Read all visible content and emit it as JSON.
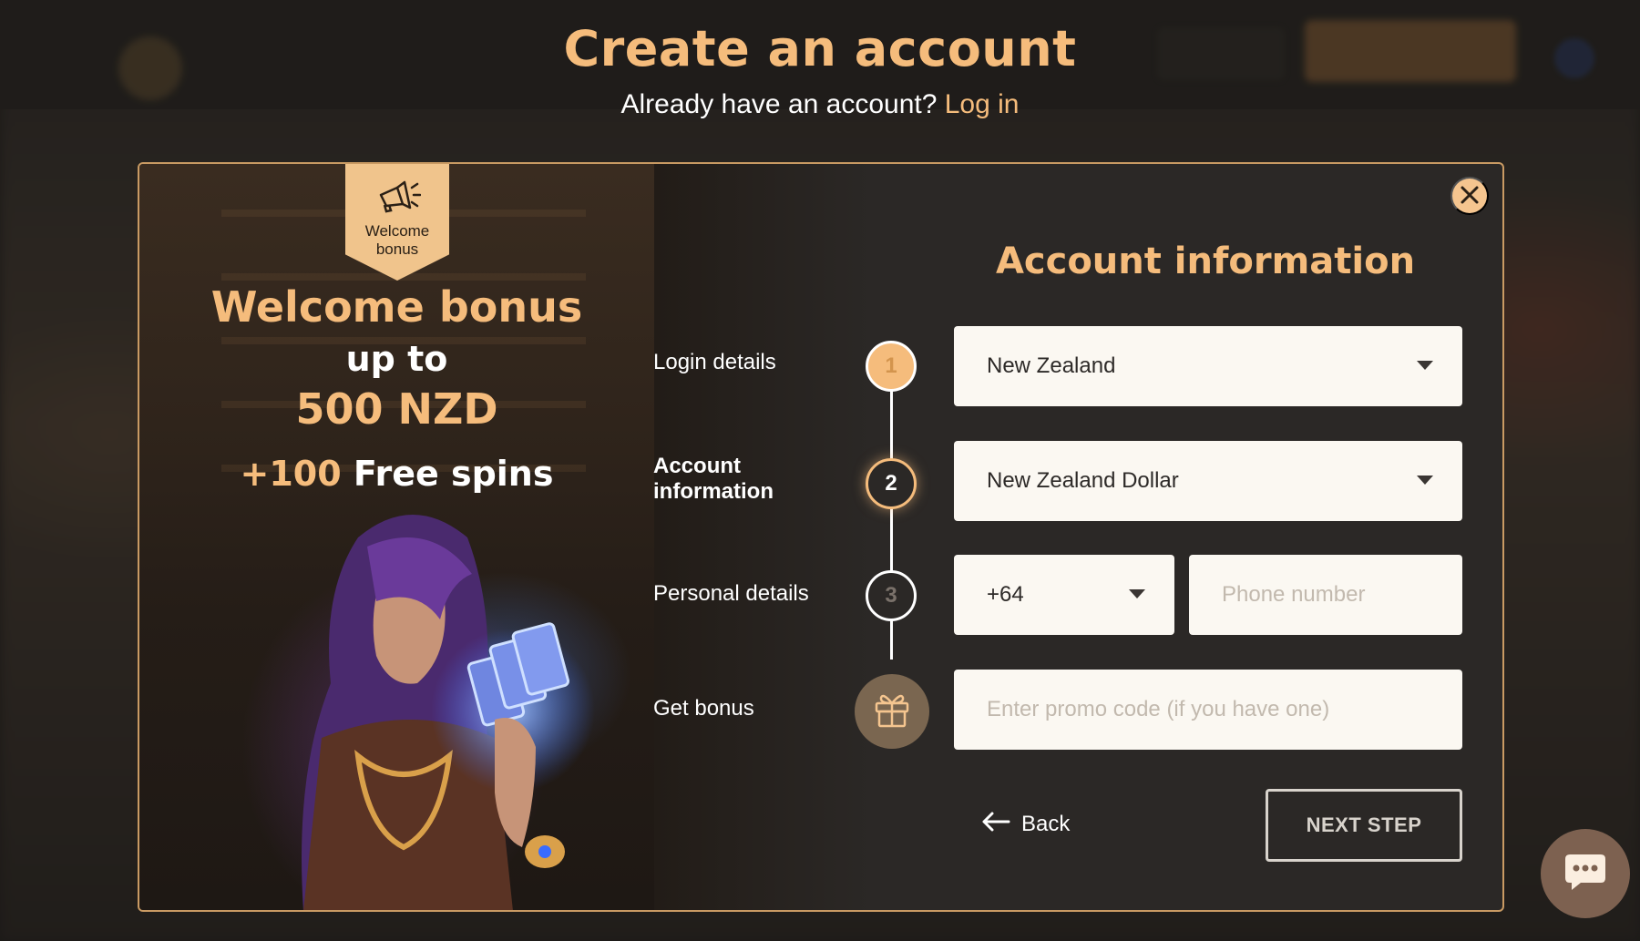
{
  "page": {
    "title": "Create an account",
    "subtitle_text": "Already have an account?",
    "login_link": "Log in"
  },
  "promo": {
    "tag_label": "Welcome bonus",
    "tag_icon": "megaphone-icon",
    "headline": "Welcome bonus",
    "upto": "up to",
    "amount": "500 NZD",
    "free_spins_count": "+100",
    "free_spins_label": "Free spins"
  },
  "steps": [
    {
      "number": "1",
      "label": "Login details",
      "state": "completed"
    },
    {
      "number": "2",
      "label": "Account information",
      "state": "active"
    },
    {
      "number": "3",
      "label": "Personal details",
      "state": "pending"
    },
    {
      "number": "",
      "label": "Get bonus",
      "state": "bonus",
      "icon": "gift-icon"
    }
  ],
  "form": {
    "section_title": "Account information",
    "country_value": "New Zealand",
    "currency_value": "New Zealand Dollar",
    "phone_code_value": "+64",
    "phone_placeholder": "Phone number",
    "promo_placeholder": "Enter promo code (if you have one)",
    "back_label": "Back",
    "next_label": "NEXT STEP"
  },
  "icons": {
    "close": "close-icon",
    "chat": "chat-icon",
    "back_arrow": "arrow-left-icon",
    "dropdown": "chevron-down-icon"
  },
  "colors": {
    "accent": "#f5bc7c",
    "modal_bg": "#2b2826",
    "field_bg": "#fbf8f2",
    "border": "#c99a63"
  }
}
